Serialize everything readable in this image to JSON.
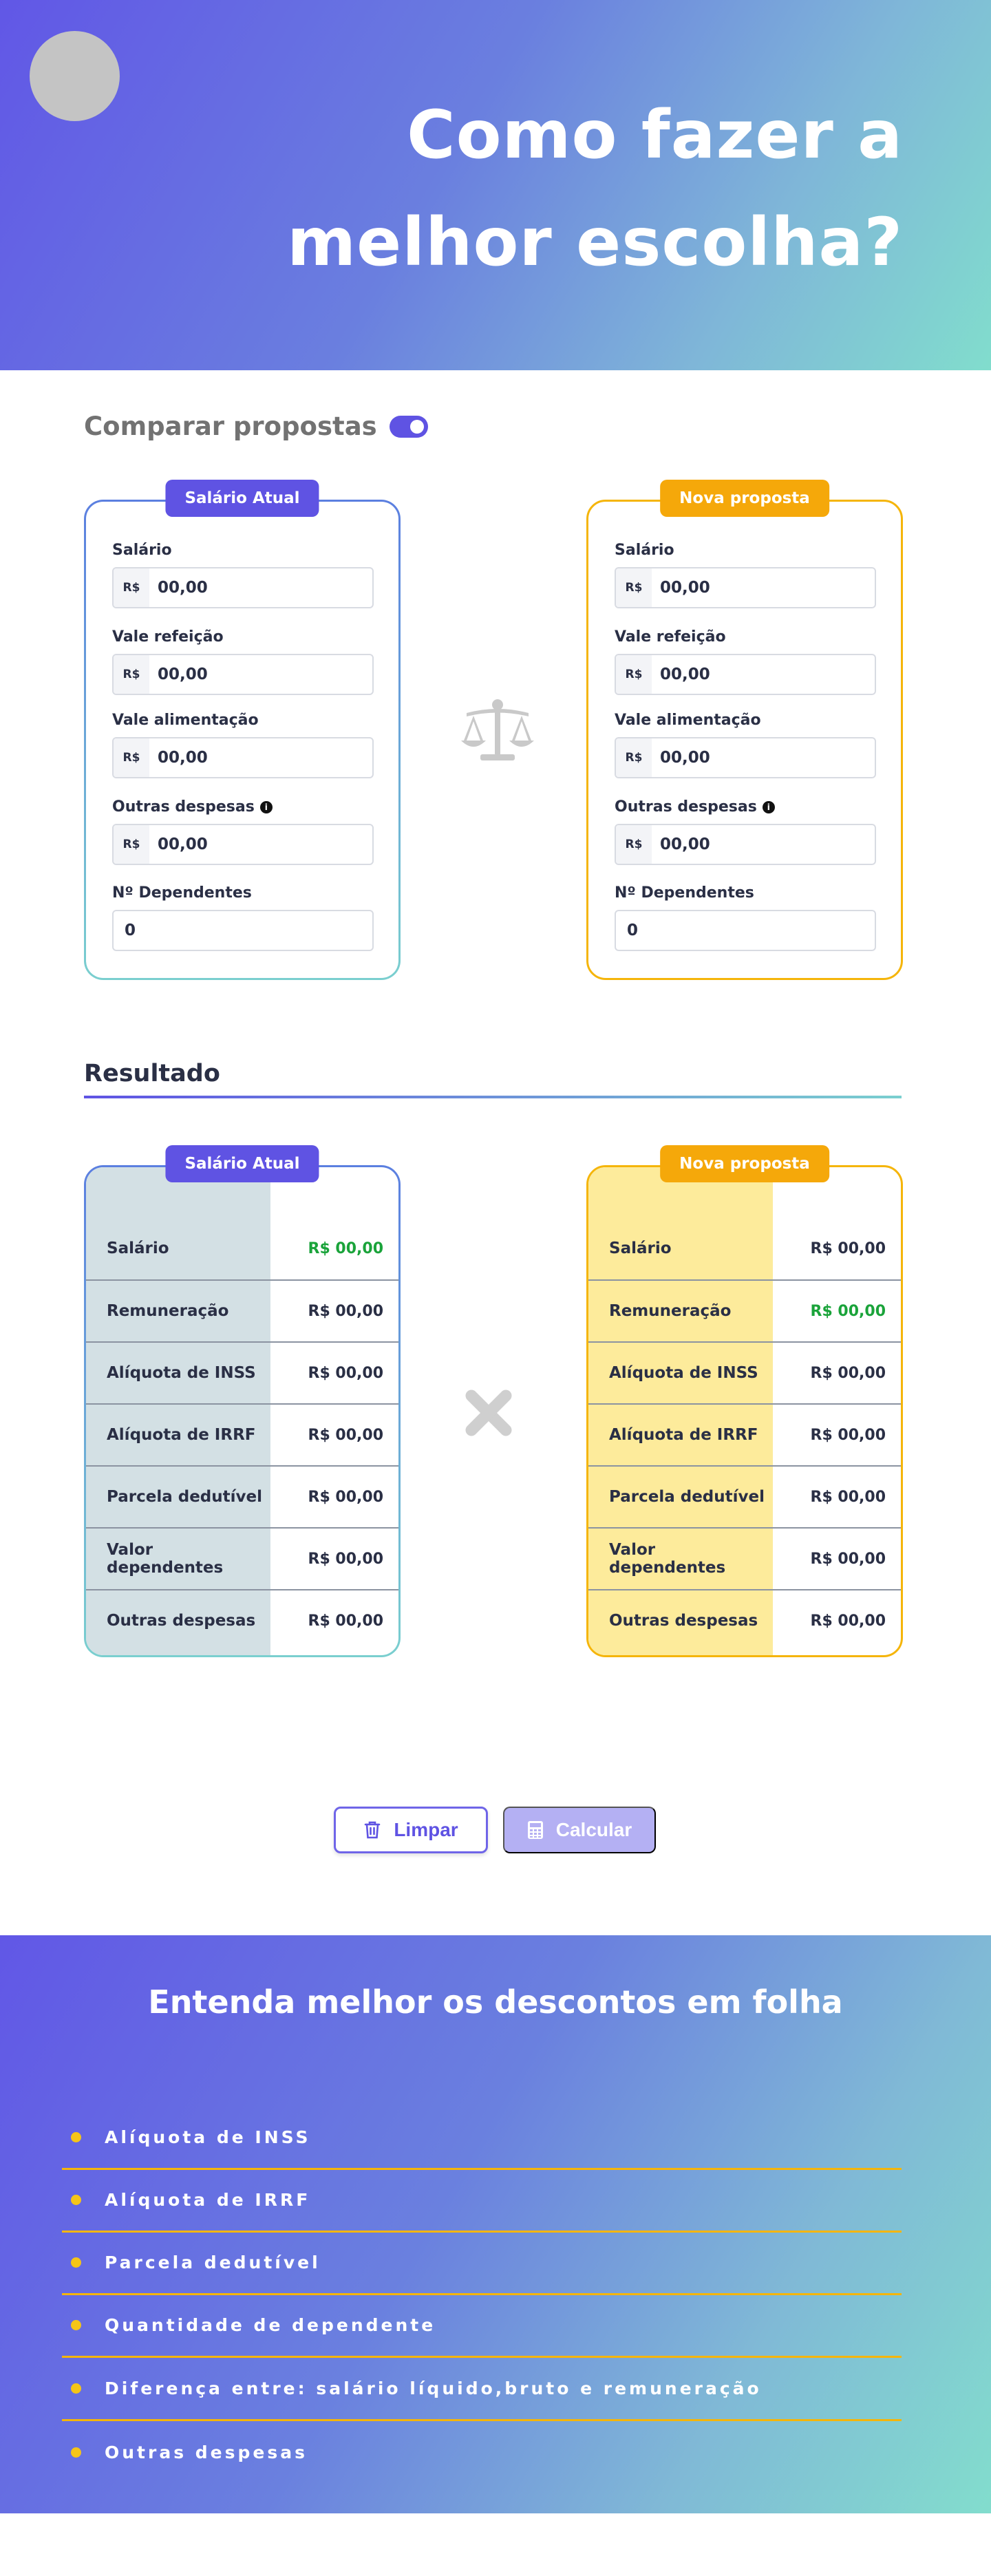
{
  "hero": {
    "title_line1": "Como fazer a",
    "title_line2": "melhor escolha?"
  },
  "compare": {
    "label": "Comparar propostas",
    "toggle_on": true
  },
  "input_cards": [
    {
      "badge": "Salário Atual",
      "fields": [
        {
          "label": "Salário",
          "prefix": "R$",
          "value": "00,00"
        },
        {
          "label": "Vale refeição",
          "prefix": "R$",
          "value": "00,00"
        },
        {
          "label": "Vale alimentação",
          "prefix": "R$",
          "value": "00,00"
        },
        {
          "label": "Outras despesas",
          "prefix": "R$",
          "value": "00,00"
        },
        {
          "label": "Nº Dependentes",
          "value": "0"
        }
      ]
    },
    {
      "badge": "Nova proposta",
      "fields": [
        {
          "label": "Salário",
          "prefix": "R$",
          "value": "00,00"
        },
        {
          "label": "Vale refeição",
          "prefix": "R$",
          "value": "00,00"
        },
        {
          "label": "Vale alimentação",
          "prefix": "R$",
          "value": "00,00"
        },
        {
          "label": "Outras despesas",
          "prefix": "R$",
          "value": "00,00"
        },
        {
          "label": "Nº Dependentes",
          "value": "0"
        }
      ]
    }
  ],
  "result": {
    "title": "Resultado",
    "cards": [
      {
        "badge": "Salário Atual",
        "rows": [
          {
            "label": "Salário",
            "value": "R$ 00,00"
          },
          {
            "label": "Remuneração",
            "value": "R$ 00,00"
          },
          {
            "label": "Alíquota de INSS",
            "value": "R$ 00,00"
          },
          {
            "label": "Alíquota de IRRF",
            "value": "R$ 00,00"
          },
          {
            "label": "Parcela dedutível",
            "value": "R$ 00,00"
          },
          {
            "label": "Valor dependentes",
            "value": "R$ 00,00"
          },
          {
            "label": "Outras despesas",
            "value": "R$ 00,00"
          }
        ]
      },
      {
        "badge": "Nova proposta",
        "rows": [
          {
            "label": "Salário",
            "value": "R$ 00,00"
          },
          {
            "label": "Remuneração",
            "value": "R$ 00,00"
          },
          {
            "label": "Alíquota de INSS",
            "value": "R$ 00,00"
          },
          {
            "label": "Alíquota de IRRF",
            "value": "R$ 00,00"
          },
          {
            "label": "Parcela dedutível",
            "value": "R$ 00,00"
          },
          {
            "label": "Valor dependentes",
            "value": "R$ 00,00"
          },
          {
            "label": "Outras despesas",
            "value": "R$ 00,00"
          }
        ]
      }
    ]
  },
  "buttons": {
    "clear_label": "Limpar",
    "calc_label": "Calcular"
  },
  "footer": {
    "title": "Entenda melhor os descontos em folha",
    "items": [
      "Alíquota de INSS",
      "Alíquota de IRRF",
      "Parcela dedutível",
      "Quantidade de dependente",
      "Diferença entre: salário líquido,bruto e remuneração",
      "Outras despesas"
    ]
  },
  "icons": {
    "scale": "scale-balance-icon",
    "compare_x": "close-x-icon",
    "trash": "trash-icon",
    "calculator": "calculator-icon",
    "info": "info-icon"
  },
  "colors": {
    "primary": "#5f53e3",
    "accent_yellow": "#f5b50a",
    "positive_green": "#1aa33a",
    "blue_label_bg": "#d3e0e4",
    "yellow_label_bg": "#fdeb9b"
  }
}
